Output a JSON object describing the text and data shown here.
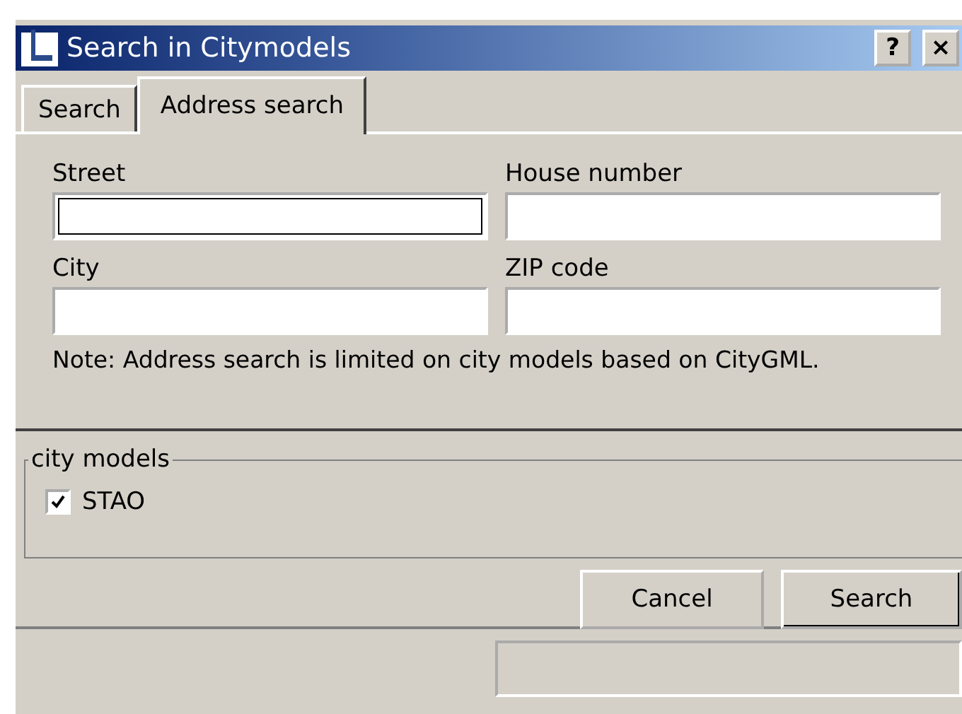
{
  "window": {
    "title": "Search in Citymodels",
    "help_button": "?",
    "close_button": "×"
  },
  "tabs": [
    {
      "label": "Search",
      "selected": false
    },
    {
      "label": "Address search",
      "selected": true
    }
  ],
  "fields": [
    {
      "label": "Street",
      "focused": true
    },
    {
      "label": "House number",
      "focused": false
    },
    {
      "label": "City",
      "focused": false
    },
    {
      "label": "ZIP code",
      "focused": false
    }
  ],
  "note": "Note: Address search is limited on city models based on CityGML.",
  "city_models": {
    "title": "city models",
    "items": [
      {
        "label": "STAO",
        "checked": true
      }
    ]
  },
  "buttons": [
    {
      "label": "Cancel",
      "default": false
    },
    {
      "label": "Search",
      "default": true
    }
  ]
}
